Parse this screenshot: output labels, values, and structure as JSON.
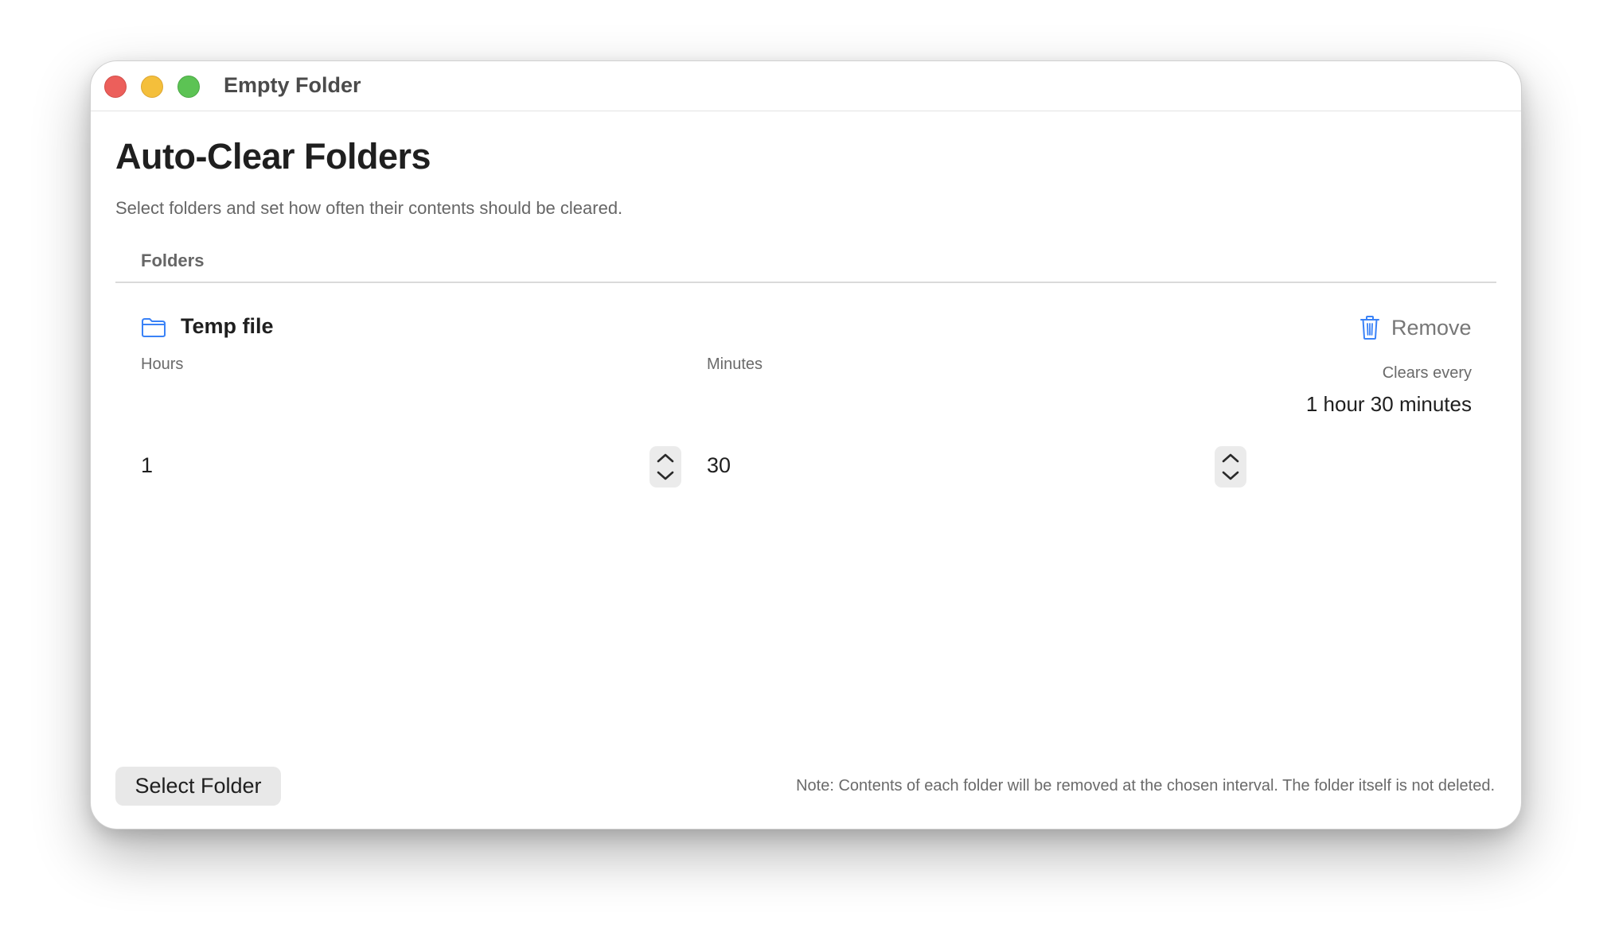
{
  "window": {
    "title": "Empty Folder"
  },
  "header": {
    "title": "Auto-Clear Folders",
    "subtitle": "Select folders and set how often their contents should be cleared."
  },
  "section": {
    "label": "Folders"
  },
  "folder": {
    "name": "Temp file",
    "icon": "folder-icon",
    "remove_label": "Remove",
    "hours_label": "Hours",
    "hours_value": "1",
    "minutes_label": "Minutes",
    "minutes_value": "30",
    "clears_label": "Clears every",
    "clears_value": "1 hour 30 minutes"
  },
  "footer": {
    "select_button": "Select Folder",
    "note": "Note: Contents of each folder will be removed at the chosen interval. The folder itself is not deleted."
  },
  "colors": {
    "accent": "#3a82f7",
    "close": "#ec5f5b",
    "minimize": "#f4bf3b",
    "zoom": "#5cc354"
  }
}
